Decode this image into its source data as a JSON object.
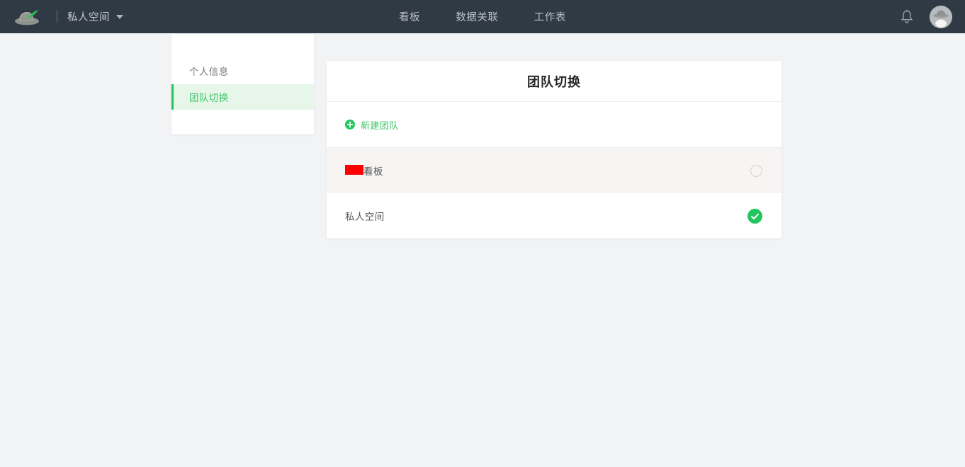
{
  "topbar": {
    "logo_icon": "hat-feather-logo",
    "workspace_name": "私人空间",
    "caret_icon": "chevron-down-icon",
    "nav_items": [
      {
        "label": "看板",
        "name": "nav-item-kanban"
      },
      {
        "label": "数据关联",
        "name": "nav-item-data-link"
      },
      {
        "label": "工作表",
        "name": "nav-item-worksheet"
      }
    ],
    "bell_icon": "notification-bell-icon",
    "avatar_icon": "user-avatar"
  },
  "sidebar": {
    "items": [
      {
        "label": "个人信息",
        "active": false
      },
      {
        "label": "团队切换",
        "active": true
      }
    ]
  },
  "card": {
    "title": "团队切换",
    "new_team": {
      "label": "新建团队",
      "icon": "plus-circle-icon"
    },
    "rows": [
      {
        "label": "看板",
        "redacted_prefix": true,
        "selected": false,
        "hovered": true,
        "radio_icon": "radio-unchecked-icon"
      },
      {
        "label": "私人空间",
        "redacted_prefix": false,
        "selected": true,
        "hovered": false,
        "radio_icon": "radio-checked-icon"
      }
    ]
  },
  "colors": {
    "topbar_bg": "#2f3a45",
    "page_bg": "#f2f3f5",
    "accent_green": "#22c55e",
    "active_nav_bg": "#e6f7ea",
    "active_nav_text": "#3dc467",
    "row_hover_bg": "#f6f5f4",
    "redaction_red": "#fe0000"
  }
}
